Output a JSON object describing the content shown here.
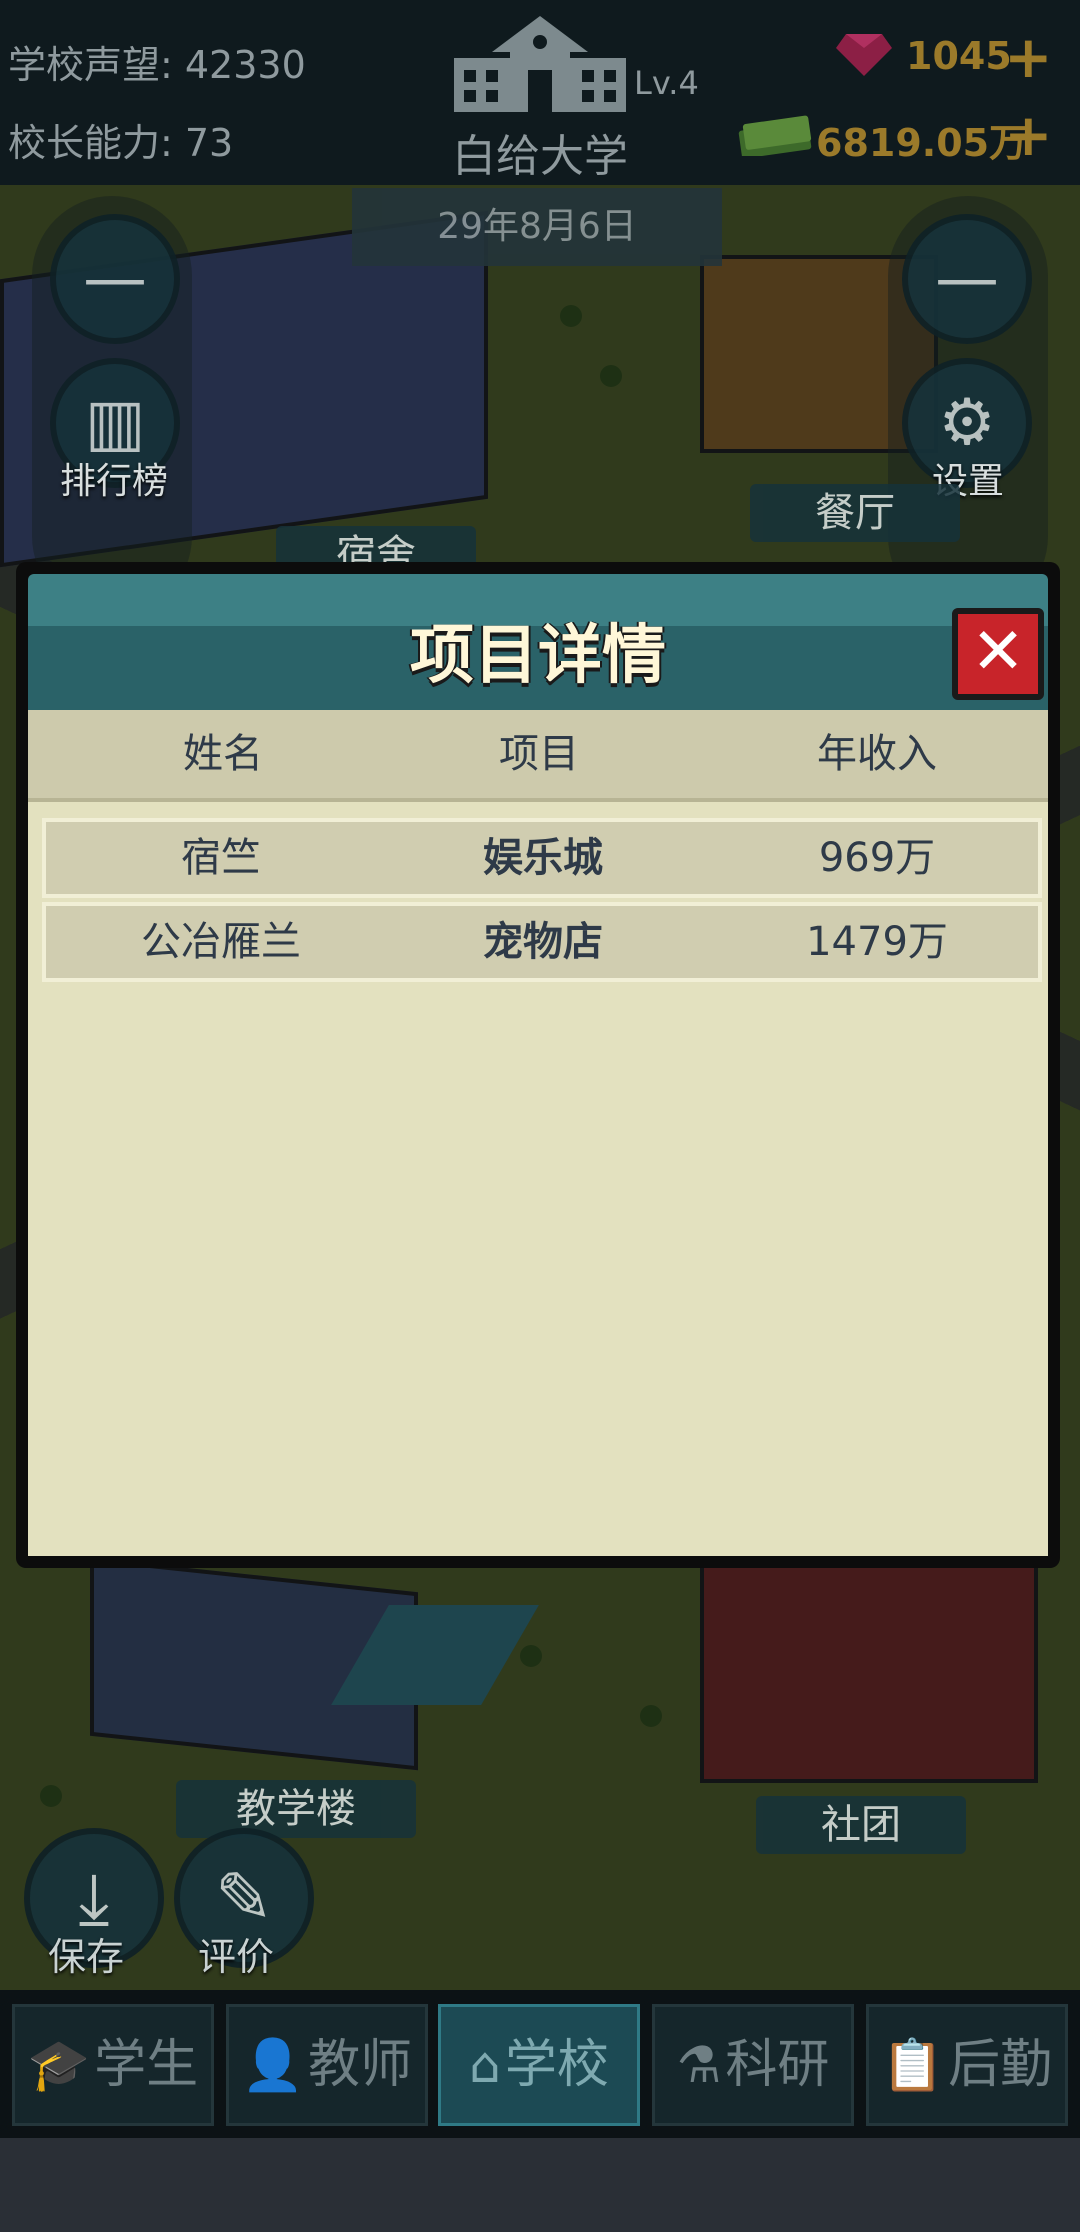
{
  "header": {
    "reputation_label": "学校声望: 42330",
    "ability_label": "校长能力: 73",
    "school_name": "白给大学",
    "level": "Lv.4",
    "gems": "1045",
    "money": "6819.05万",
    "date": "29年8月6日"
  },
  "map": {
    "left_buttons": {
      "rank_label": "排行榜"
    },
    "right_buttons": {
      "settings_label": "设置"
    },
    "labels": {
      "dorm": "宿舍",
      "canteen": "餐厅",
      "teaching": "教学楼",
      "club": "社团"
    },
    "tools": {
      "save_label": "保存",
      "review_label": "评价"
    }
  },
  "modal": {
    "title": "项目详情",
    "close_glyph": "✕",
    "columns": [
      "姓名",
      "项目",
      "年收入"
    ],
    "rows": [
      {
        "name": "宿竺",
        "project": "娱乐城",
        "income": "969万"
      },
      {
        "name": "公冶雁兰",
        "project": "宠物店",
        "income": "1479万"
      }
    ]
  },
  "tabs": [
    {
      "label": "学生",
      "icon": "student-icon",
      "active": false
    },
    {
      "label": "教师",
      "icon": "teacher-icon",
      "active": false
    },
    {
      "label": "学校",
      "icon": "school-icon",
      "active": true
    },
    {
      "label": "科研",
      "icon": "flask-icon",
      "active": false
    },
    {
      "label": "后勤",
      "icon": "clipboard-icon",
      "active": false
    }
  ],
  "colors": {
    "accent": "#2c6a70",
    "close": "#c8242a",
    "panel": "#e3e1bf",
    "gold": "#9b7a2a"
  }
}
